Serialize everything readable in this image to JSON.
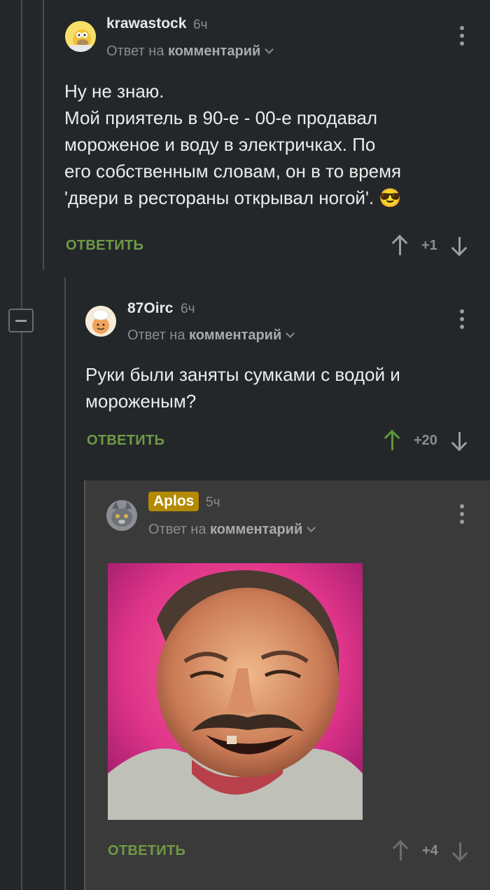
{
  "comments": [
    {
      "username": "krawastock",
      "time": "6ч",
      "reply_prefix": "Ответ на",
      "reply_target": "комментарий",
      "lines": [
        "Ну не знаю.",
        "Мой приятель в 90-е - 00-е продавал",
        "мороженое и воду в электричках. По",
        "его собственным словам, он в то время",
        "'двери в рестораны открывал ногой'. 😎"
      ],
      "reply_label": "ОТВЕТИТЬ",
      "score": "+1"
    },
    {
      "username": "87Oirc",
      "time": "6ч",
      "reply_prefix": "Ответ на",
      "reply_target": "комментарий",
      "lines": [
        "Руки были заняты сумками с водой и",
        "мороженым?"
      ],
      "reply_label": "ОТВЕТИТЬ",
      "score": "+20"
    },
    {
      "username": "Aplos",
      "time": "5ч",
      "reply_prefix": "Ответ на",
      "reply_target": "комментарий",
      "reply_label": "ОТВЕТИТЬ",
      "score": "+4"
    }
  ],
  "colors": {
    "background": "#24272a",
    "nested_background": "#3a3a3a",
    "reply_green": "#6f9a46",
    "upvoted_green": "#5a9a3a",
    "username_badge": "#b38a00"
  }
}
